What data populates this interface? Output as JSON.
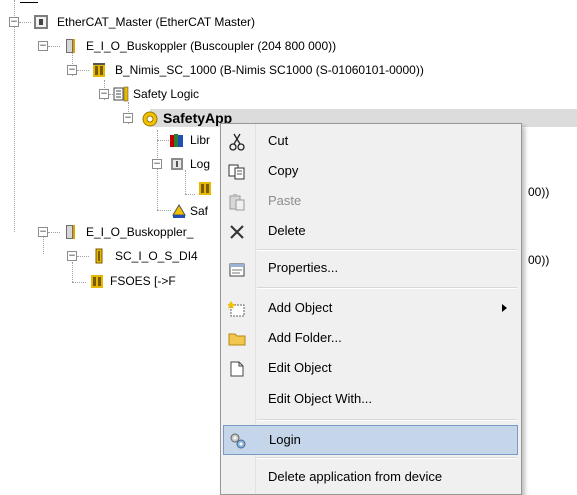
{
  "tree": {
    "master": "EtherCAT_Master (EtherCAT Master)",
    "buskoppler1": "E_I_O_Buskoppler (Buscoupler (204 800 000))",
    "nimis": "B_Nimis_SC_1000 (B-Nimis SC1000 (S-01060101-0000))",
    "safety_logic": "Safety Logic",
    "safety_app": "SafetyApp",
    "library": "Libr",
    "logical": "Log",
    "truncated_1": "00))",
    "safety_task": "Saf",
    "buskoppler2": "E_I_O_Buskoppler_",
    "sc_io": "SC_I_O_S_DI4",
    "truncated_2": "00))",
    "fsoes": "FSOES [->F"
  },
  "context_menu": {
    "items": [
      {
        "label": "Cut",
        "icon": "scissors-icon"
      },
      {
        "label": "Copy",
        "icon": "copy-icon"
      },
      {
        "label": "Paste",
        "icon": "paste-icon",
        "disabled": true
      },
      {
        "label": "Delete",
        "icon": "delete-x-icon"
      },
      {
        "label": "Properties...",
        "icon": "properties-icon"
      },
      {
        "label": "Add Object",
        "icon": "add-object-icon",
        "submenu": true
      },
      {
        "label": "Add Folder...",
        "icon": "folder-icon"
      },
      {
        "label": "Edit Object",
        "icon": "edit-object-icon"
      },
      {
        "label": "Edit Object With...",
        "icon": ""
      },
      {
        "label": "Login",
        "icon": "login-gears-icon",
        "highlighted": true
      },
      {
        "label": "Delete application from device",
        "icon": ""
      }
    ]
  },
  "colors": {
    "selection_row": "#dcdcdc",
    "menu_bg": "#f0f0f0",
    "menu_highlight": "#c6d6ea",
    "menu_highlight_border": "#7a9ac2",
    "disabled_text": "#8d8d8d"
  }
}
